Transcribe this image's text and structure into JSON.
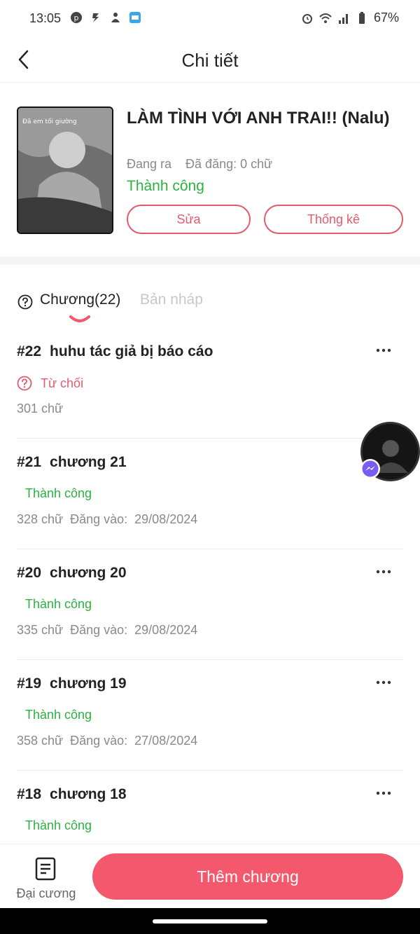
{
  "status_bar": {
    "time": "13:05",
    "battery": "67%",
    "left_icons": [
      "pinterest-icon",
      "flash-icon",
      "vacuum-icon",
      "noveltoon-icon"
    ],
    "right_icons": [
      "alarm-icon",
      "wifi-icon",
      "signal-icon",
      "battery-icon"
    ]
  },
  "header": {
    "title": "Chi tiết",
    "back_icon": "chevron-left-icon"
  },
  "story": {
    "title": "LÀM TÌNH VỚI ANH TRAI!! (Nalu)",
    "cover_text": "Đã em tối giường",
    "state": "Đang ra",
    "published_words": "Đã đăng: 0 chữ",
    "status": "Thành công",
    "edit_label": "Sửa",
    "stats_label": "Thống kê"
  },
  "tabs": {
    "chapters_label": "Chương(22)",
    "drafts_label": "Bản nháp"
  },
  "chapters": [
    {
      "number": "#22",
      "title": "huhu tác giả bị báo cáo",
      "status": "Từ chối",
      "words": "301 chữ",
      "posted_label": "",
      "posted_date": ""
    },
    {
      "number": "#21",
      "title": "chương 21",
      "status": "Thành công",
      "words": "328 chữ",
      "posted_label": "Đăng vào:",
      "posted_date": "29/08/2024"
    },
    {
      "number": "#20",
      "title": "chương 20",
      "status": "Thành công",
      "words": "335 chữ",
      "posted_label": "Đăng vào:",
      "posted_date": "29/08/2024"
    },
    {
      "number": "#19",
      "title": "chương 19",
      "status": "Thành công",
      "words": "358 chữ",
      "posted_label": "Đăng vào:",
      "posted_date": "27/08/2024"
    },
    {
      "number": "#18",
      "title": "chương 18",
      "status": "Thành công",
      "words": "",
      "posted_label": "",
      "posted_date": ""
    }
  ],
  "bottom": {
    "outline_label": "Đại cương",
    "add_chapter_label": "Thêm chương"
  },
  "colors": {
    "accent": "#f4586d",
    "outline_accent": "#e35a6d",
    "success": "#2db143",
    "muted": "#8a8a8a"
  }
}
